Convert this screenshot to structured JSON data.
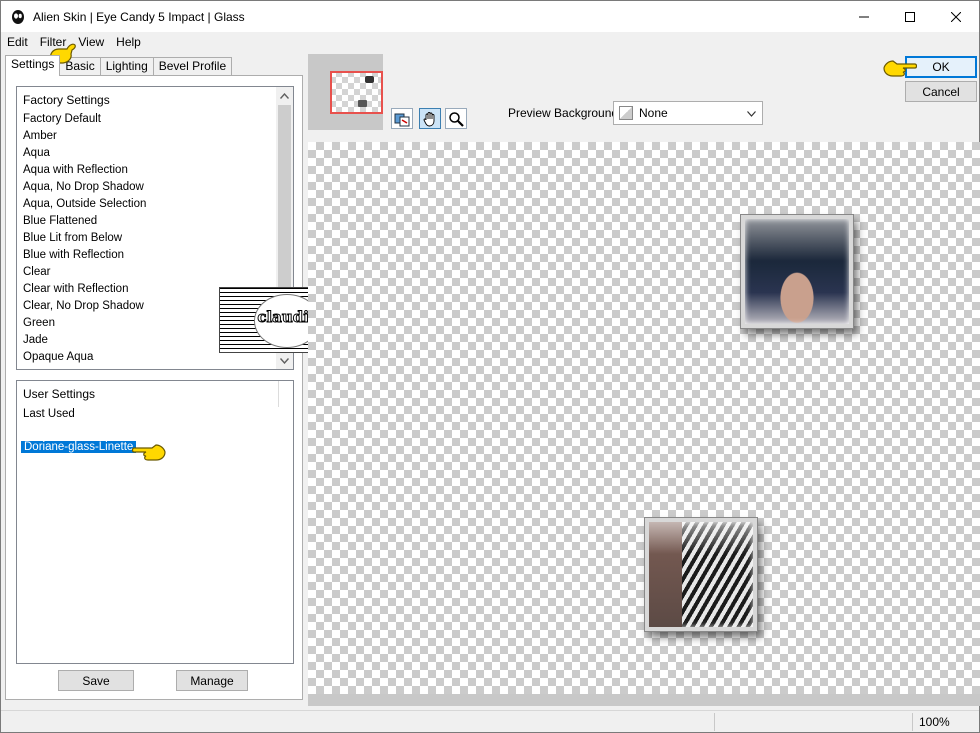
{
  "window": {
    "title": "Alien Skin | Eye Candy 5 Impact | Glass"
  },
  "menu": [
    "Edit",
    "Filter",
    "View",
    "Help"
  ],
  "tabs": [
    "Settings",
    "Basic",
    "Lighting",
    "Bevel Profile"
  ],
  "factory_settings": {
    "heading": "Factory Settings",
    "items": [
      "Factory Default",
      "Amber",
      "Aqua",
      "Aqua with Reflection",
      "Aqua, No Drop Shadow",
      "Aqua, Outside Selection",
      "Blue Flattened",
      "Blue Lit from Below",
      "Blue with Reflection",
      "Clear",
      "Clear with Reflection",
      "Clear, No Drop Shadow",
      "Green",
      "Jade",
      "Opaque Aqua"
    ]
  },
  "user_settings": {
    "heading": "User Settings",
    "items": [
      "Last Used"
    ],
    "selected": "Doriane-glass-Linette"
  },
  "buttons": {
    "save": "Save",
    "manage": "Manage",
    "ok": "OK",
    "cancel": "Cancel"
  },
  "preview": {
    "background_label": "Preview Background:",
    "background_value": "None"
  },
  "watermark": {
    "text": "claudia"
  },
  "status": {
    "zoom": "100%"
  },
  "colors": {
    "selection": "#0078d7",
    "thumb_frame": "#e8514d",
    "pointer": "#ffd800"
  }
}
